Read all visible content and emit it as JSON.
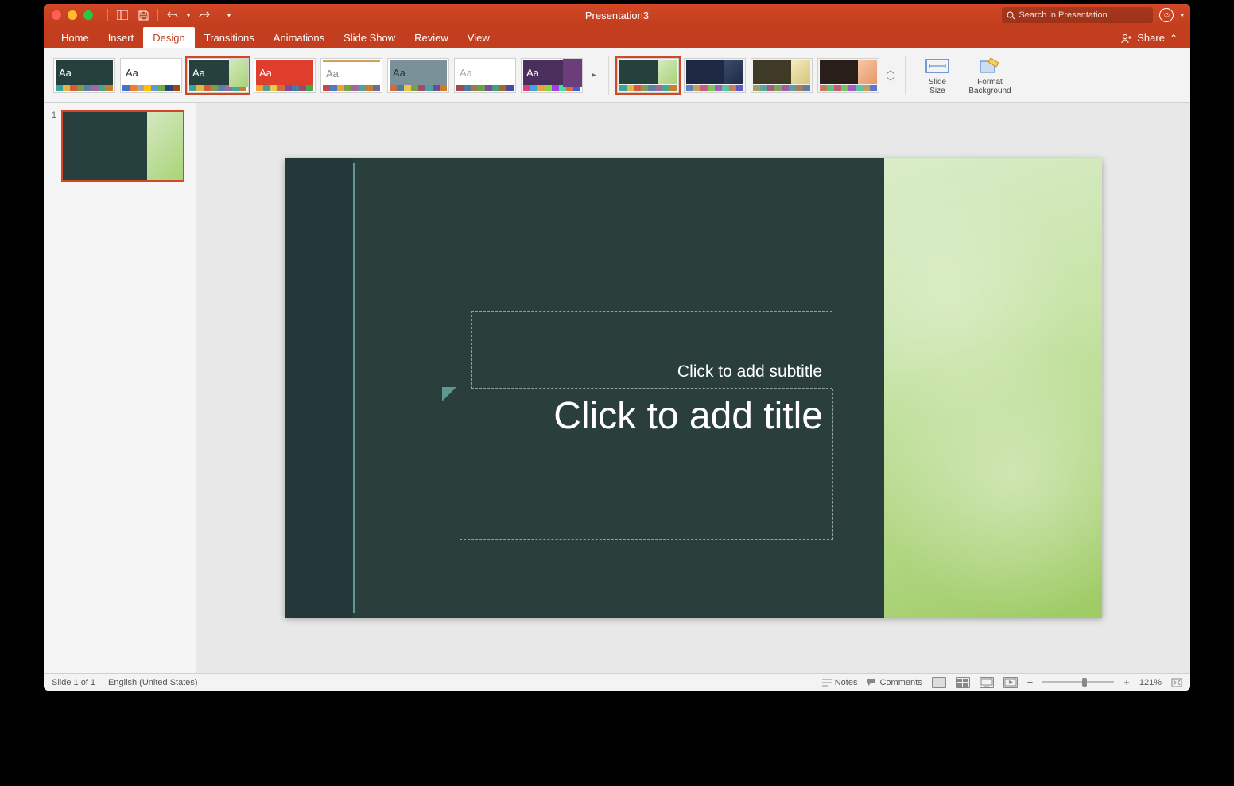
{
  "title": "Presentation3",
  "search_placeholder": "Search in Presentation",
  "share_label": "Share",
  "tabs": [
    "Home",
    "Insert",
    "Design",
    "Transitions",
    "Animations",
    "Slide Show",
    "Review",
    "View"
  ],
  "active_tab": 2,
  "ribbon": {
    "slide_size": "Slide\nSize",
    "format_bg": "Format\nBackground"
  },
  "themes": [
    {
      "bg": "#26403d",
      "fg": "#fff",
      "bars": [
        "#3ba39e",
        "#e0b54a",
        "#d35c3b",
        "#7b9e4e",
        "#5c7fa3",
        "#9e6b9e",
        "#4aa68b",
        "#c97d2e"
      ]
    },
    {
      "bg": "#ffffff",
      "fg": "#333",
      "bars": [
        "#4472c4",
        "#ed7d31",
        "#a5a5a5",
        "#ffc000",
        "#5b9bd5",
        "#70ad47",
        "#264478",
        "#9e480e"
      ]
    },
    {
      "bg": "#26403d",
      "fg": "#fff",
      "bars": [
        "#3ba39e",
        "#e0b54a",
        "#d35c3b",
        "#7b9e4e",
        "#5c7fa3",
        "#9e6b9e",
        "#4aa68b",
        "#c97d2e"
      ],
      "sel": true,
      "side": "linear-gradient(135deg,#d5e8c0,#a8d478)"
    },
    {
      "bg": "#e03e2d",
      "fg": "#fff",
      "bars": [
        "#f2a33c",
        "#4a9e9e",
        "#e8c94a",
        "#d06b3b",
        "#7b4aa3",
        "#4a7ba3",
        "#9e4a6b",
        "#4aa34a"
      ]
    },
    {
      "bg": "#ffffff",
      "fg": "#888",
      "bars": [
        "#c44a4a",
        "#4a7bc4",
        "#e8a33c",
        "#7b9e4a",
        "#9e6b9e",
        "#4aa39e",
        "#c97d2e",
        "#6b6b9e"
      ],
      "border": "#d0a060"
    },
    {
      "bg": "#7a9199",
      "fg": "#333",
      "bars": [
        "#d06b3b",
        "#4a7ba3",
        "#e8c94a",
        "#7b9e4a",
        "#9e4a6b",
        "#4aa39e",
        "#6b4a9e",
        "#c97d2e"
      ]
    },
    {
      "bg": "#ffffff",
      "fg": "#aaa",
      "bars": [
        "#9e4a4a",
        "#4a7b9e",
        "#9e7b4a",
        "#6b9e4a",
        "#7b4a9e",
        "#4a9e7b",
        "#9e6b2e",
        "#4a4a9e"
      ]
    },
    {
      "bg": "#4a2e5c",
      "fg": "#fff",
      "bars": [
        "#e03e7b",
        "#3ea3e0",
        "#e0a33e",
        "#7be03e",
        "#a33ee0",
        "#3ee0a3",
        "#e06b3e",
        "#3e5ce0"
      ],
      "side": "#6b3e7b"
    }
  ],
  "variants": [
    {
      "main": "#26403d",
      "side": "linear-gradient(135deg,#d5e8c0,#a8d478)",
      "bars": [
        "#3ba39e",
        "#e0b54a",
        "#d35c3b",
        "#7b9e4e",
        "#5c7fa3",
        "#9e6b9e",
        "#4aa68b",
        "#c97d2e"
      ],
      "sel": true
    },
    {
      "main": "#1e2a44",
      "side": "linear-gradient(135deg,#3a4a6b,#1e2a44)",
      "bars": [
        "#5c7fc4",
        "#c4a35c",
        "#c45c7f",
        "#7fc45c",
        "#a35cc4",
        "#5cc4a3",
        "#c47f5c",
        "#5c5cc4"
      ]
    },
    {
      "main": "#3e3a26",
      "side": "linear-gradient(135deg,#f5ecc0,#d5c478)",
      "bars": [
        "#a39e5c",
        "#5ca39e",
        "#a35c7f",
        "#7fa35c",
        "#9e5ca3",
        "#5c9ea3",
        "#a37f5c",
        "#5c7fa3"
      ]
    },
    {
      "main": "#2a1e1a",
      "side": "linear-gradient(135deg,#f5c8a8,#e89564)",
      "bars": [
        "#c4785c",
        "#5cc478",
        "#c45c78",
        "#78c45c",
        "#a35cc4",
        "#5cc4a3",
        "#c49e5c",
        "#5c78c4"
      ]
    }
  ],
  "thumb_num": "1",
  "slide": {
    "subtitle_placeholder": "Click to add subtitle",
    "title_placeholder": "Click to add title"
  },
  "status": {
    "slide_pos": "Slide 1 of 1",
    "lang": "English (United States)",
    "notes": "Notes",
    "comments": "Comments",
    "zoom": "121%"
  }
}
